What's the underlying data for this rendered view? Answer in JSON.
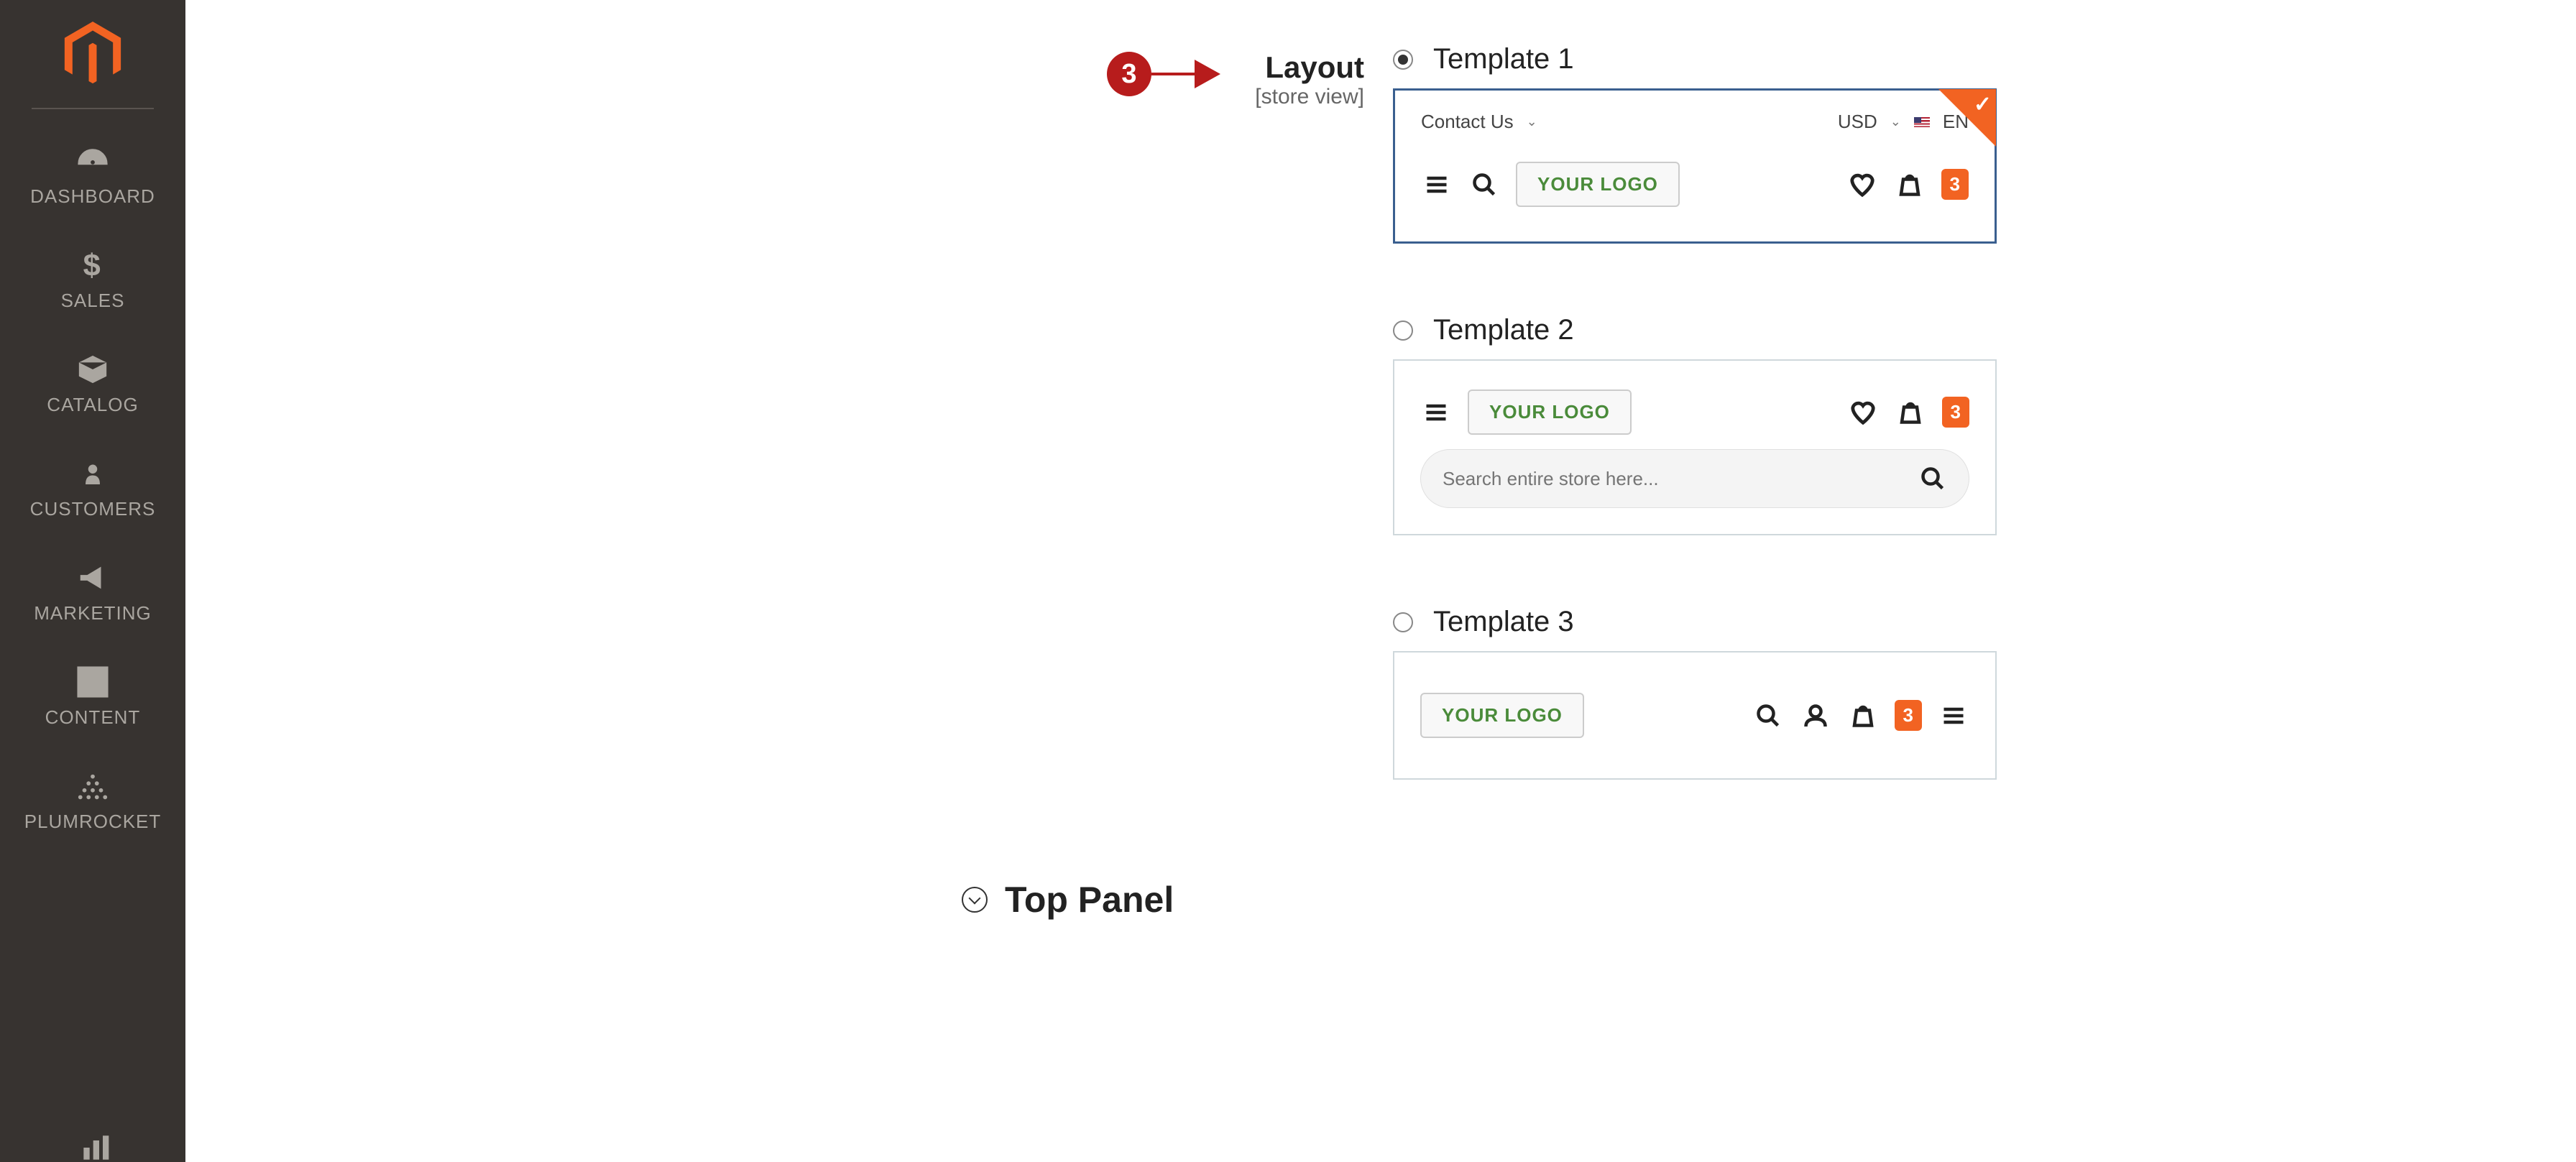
{
  "sidebar": {
    "items": [
      {
        "label": "DASHBOARD"
      },
      {
        "label": "SALES"
      },
      {
        "label": "CATALOG"
      },
      {
        "label": "CUSTOMERS"
      },
      {
        "label": "MARKETING"
      },
      {
        "label": "CONTENT"
      },
      {
        "label": "PLUMROCKET"
      }
    ]
  },
  "callout": {
    "number": "3"
  },
  "layout": {
    "label": "Layout",
    "scope": "[store view]",
    "options": [
      {
        "label": "Template 1",
        "selected": true
      },
      {
        "label": "Template 2",
        "selected": false
      },
      {
        "label": "Template 3",
        "selected": false
      }
    ]
  },
  "preview": {
    "contact": "Contact Us",
    "currency": "USD",
    "language": "EN",
    "logo": "YOUR LOGO",
    "cart_count": "3",
    "search_placeholder": "Search entire store here..."
  },
  "section": {
    "title": "Top Panel"
  }
}
